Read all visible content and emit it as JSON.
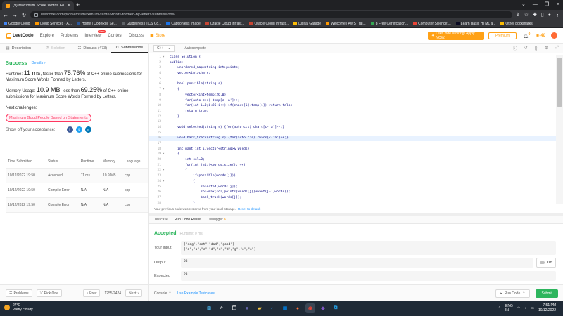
{
  "browser": {
    "tab_title": "(9) Maximum Score Words Form",
    "url": "leetcode.com/problems/maximum-score-words-formed-by-letters/submissions/",
    "bookmarks": [
      {
        "label": "Google Cloud",
        "color": "#4285f4"
      },
      {
        "label": "Cloud Services - A...",
        "color": "#ff9900"
      },
      {
        "label": "Home | CodeRite Se...",
        "color": "#2b579a"
      },
      {
        "label": "Guidelines | TCS Co...",
        "color": "#5f6368"
      },
      {
        "label": "Captionless Image",
        "color": "#1a73e8"
      },
      {
        "label": "Oracle Cloud Infrast...",
        "color": "#c74634"
      },
      {
        "label": "Oracle Cloud Infrast...",
        "color": "#c74634"
      },
      {
        "label": "Digital Garage",
        "color": "#fbbc05"
      },
      {
        "label": "Welcome | AWS Trai...",
        "color": "#ff9900"
      },
      {
        "label": "8 Free Certification...",
        "color": "#34a853"
      },
      {
        "label": "Computer Science:...",
        "color": "#ea4335"
      },
      {
        "label": "Learn Basic HTML a...",
        "color": "#0a0a23"
      },
      {
        "label": "Other bookmarks",
        "color": "#fbbc05"
      }
    ]
  },
  "nav": {
    "logo": "LeetCode",
    "links": [
      "Explore",
      "Problems",
      "Interview",
      "Contest",
      "Discuss"
    ],
    "new_badge": "New",
    "store": "Store",
    "promo": "LeetCode is hiring! Apply NOW.",
    "premium": "Premium",
    "notif_count": "0",
    "coins": "40"
  },
  "left_tabs": [
    {
      "label": "Description",
      "state": "normal"
    },
    {
      "label": "Solution",
      "state": "dim"
    },
    {
      "label": "Discuss (473)",
      "state": "normal"
    },
    {
      "label": "Submissions",
      "state": "active"
    }
  ],
  "result": {
    "status": "Success",
    "details": "Details",
    "runtime_prefix": "Runtime:",
    "runtime_value": "11 ms",
    "runtime_mid": ", faster than",
    "runtime_pct": "75.76%",
    "runtime_suffix": "of C++ online submissions for Maximum Score Words Formed by Letters.",
    "memory_prefix": "Memory Usage:",
    "memory_value": "10.9 MB",
    "memory_mid": ", less than",
    "memory_pct": "69.25%",
    "memory_suffix": "of C++ online submissions for Maximum Score Words Formed by Letters.",
    "next_challenges": "Next challenges:",
    "challenge": "Maximum Good People Based on Statements",
    "share": "Show off your acceptance:"
  },
  "table": {
    "headers": [
      "Time Submitted",
      "Status",
      "Runtime",
      "Memory",
      "Language"
    ],
    "rows": [
      {
        "time": "10/12/2022 19:50",
        "status": "Accepted",
        "runtime": "11 ms",
        "memory": "10.9 MB",
        "lang": "cpp"
      },
      {
        "time": "10/12/2022 19:50",
        "status": "Compile Error",
        "runtime": "N/A",
        "memory": "N/A",
        "lang": "cpp"
      },
      {
        "time": "10/12/2022 19:50",
        "status": "Compile Error",
        "runtime": "N/A",
        "memory": "N/A",
        "lang": "cpp"
      }
    ]
  },
  "left_footer": {
    "problems": "Problems",
    "pick_one": "Pick One",
    "prev": "Prev",
    "page": "1255/2424",
    "next": "Next"
  },
  "editor": {
    "language": "C++",
    "autocomplete": "Autocomplete",
    "lines": [
      {
        "n": "1",
        "f": "▾",
        "t": "class Solution {"
      },
      {
        "n": "2",
        "f": "",
        "t": "public:"
      },
      {
        "n": "3",
        "f": "",
        "t": "    unordered_map<string,int>points;"
      },
      {
        "n": "4",
        "f": "",
        "t": "    vector<int>chars;"
      },
      {
        "n": "5",
        "f": "",
        "t": ""
      },
      {
        "n": "6",
        "f": "",
        "t": "    bool possible(string s)"
      },
      {
        "n": "7",
        "f": "▾",
        "t": "    {"
      },
      {
        "n": "8",
        "f": "",
        "t": "        vector<int>temp(26,0);"
      },
      {
        "n": "9",
        "f": "",
        "t": "        for(auto c:s) temp[c-'a']++;"
      },
      {
        "n": "10",
        "f": "",
        "t": "        for(int i=0;i<26;i++) if(chars[i]<temp[i]) return false;"
      },
      {
        "n": "11",
        "f": "",
        "t": "        return true;"
      },
      {
        "n": "12",
        "f": "",
        "t": "    }"
      },
      {
        "n": "13",
        "f": "",
        "t": ""
      },
      {
        "n": "14",
        "f": "",
        "t": "    void selected(string s) {for(auto c:s) chars[c-'a']--;}"
      },
      {
        "n": "15",
        "f": "",
        "t": ""
      },
      {
        "n": "16",
        "f": "",
        "t": "    void back_track(string s) {for(auto c:s) chars[c-'a']++;}",
        "hl": true
      },
      {
        "n": "17",
        "f": "",
        "t": ""
      },
      {
        "n": "18",
        "f": "",
        "t": "    int want(int i,vector<string>& words)"
      },
      {
        "n": "19",
        "f": "▾",
        "t": "    {"
      },
      {
        "n": "20",
        "f": "",
        "t": "        int sol=0;"
      },
      {
        "n": "21",
        "f": "",
        "t": "        for(int j=i;j<words.size();j++)"
      },
      {
        "n": "22",
        "f": "▾",
        "t": "        {"
      },
      {
        "n": "23",
        "f": "",
        "t": "            if(possible(words[j]))"
      },
      {
        "n": "24",
        "f": "▾",
        "t": "            {"
      },
      {
        "n": "25",
        "f": "",
        "t": "                selected(words[j]);"
      },
      {
        "n": "26",
        "f": "",
        "t": "                sol=max(sol,points[words[j]]+want(j+1,words));"
      },
      {
        "n": "27",
        "f": "",
        "t": "                back_track(words[j]);"
      },
      {
        "n": "28",
        "f": "",
        "t": "            }"
      },
      {
        "n": "29",
        "f": "",
        "t": "        }"
      },
      {
        "n": "30",
        "f": "",
        "t": "        return sol;"
      },
      {
        "n": "31",
        "f": "",
        "t": "    }"
      },
      {
        "n": "32",
        "f": "",
        "t": ""
      },
      {
        "n": "33",
        "f": "",
        "t": "    int maxScoreWords(vector<string>& words, vector<char>& letters, vector<int>& score)"
      }
    ],
    "restore_msg": "Your previous code was restored from your local storage.",
    "restore_link": "Reset to default"
  },
  "console": {
    "tabs": [
      "Testcase",
      "Run Code Result",
      "Debugger"
    ],
    "accepted": "Accepted",
    "runtime": "Runtime: 0 ms",
    "your_input_label": "Your input",
    "your_input_line1": "[\"dog\",\"cat\",\"dad\",\"good\"]",
    "your_input_line2": "[\"a\",\"a\",\"c\",\"d\",\"d\",\"d\",\"g\",\"o\",\"o\"]",
    "output_label": "Output",
    "output": "23",
    "expected_label": "Expected",
    "expected": "23",
    "diff": "Diff",
    "console_btn": "Console",
    "use_example": "Use Example Testcases",
    "run_code": "Run Code",
    "submit": "Submit"
  },
  "taskbar": {
    "temp": "27°C",
    "weather": "Partly cloudy",
    "lang1": "ENG",
    "lang2": "IN",
    "time": "7:51 PM",
    "date": "10/12/2022"
  }
}
